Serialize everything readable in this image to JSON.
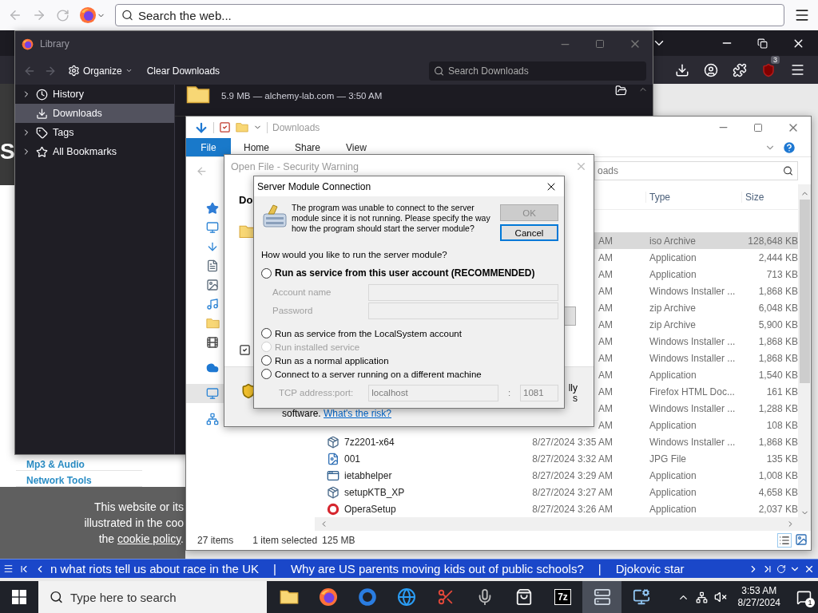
{
  "browser": {
    "search": {
      "placeholder": "Search the web..."
    },
    "extension_badge": "3",
    "page": {
      "logo_fragment": "S",
      "links": [
        "Mp3 & Audio",
        "Network Tools"
      ],
      "cookie_banner": {
        "lines": [
          "This website or its",
          "illustrated in the coo"
        ],
        "last_line": {
          "before": "the ",
          "link": "cookie policy",
          "after": "."
        }
      }
    }
  },
  "library": {
    "title": "Library",
    "organize": "Organize",
    "clear_button": "Clear Downloads",
    "search": {
      "placeholder": "Search Downloads"
    },
    "sidebar": [
      {
        "kind": "history",
        "label": "History",
        "expandable": true,
        "selected": false
      },
      {
        "kind": "downloads",
        "label": "Downloads",
        "expandable": false,
        "selected": true
      },
      {
        "kind": "tags",
        "label": "Tags",
        "expandable": true,
        "selected": false
      },
      {
        "kind": "bookmarks",
        "label": "All Bookmarks",
        "expandable": true,
        "selected": false
      }
    ],
    "download": {
      "details": "5.9 MB — alchemy-lab.com — 3:50 AM"
    }
  },
  "explorer": {
    "title": "Downloads",
    "ribbon_tabs": [
      {
        "label": "File",
        "selected": true
      },
      {
        "label": "Home",
        "selected": false
      },
      {
        "label": "Share",
        "selected": false
      },
      {
        "label": "View",
        "selected": false
      }
    ],
    "search": {
      "placeholder": "oads"
    },
    "nav_pane": [
      [
        {
          "kind": "quick-access",
          "selected": false
        },
        {
          "kind": "desktop",
          "selected": false
        },
        {
          "kind": "downloads",
          "selected": false
        },
        {
          "kind": "documents",
          "selected": false
        },
        {
          "kind": "pictures",
          "selected": false
        },
        {
          "kind": "music",
          "selected": false
        },
        {
          "kind": "folder",
          "selected": false
        },
        {
          "kind": "videos",
          "selected": false
        }
      ],
      [
        {
          "kind": "onedrive",
          "selected": false
        }
      ],
      [
        {
          "kind": "this-pc",
          "selected": true
        }
      ],
      [
        {
          "kind": "network",
          "selected": false
        }
      ]
    ],
    "columns": [
      "Type",
      "Size"
    ],
    "rows": [
      {
        "date": "AM",
        "type": "iso Archive",
        "size": "128,648 KB",
        "selected": true
      },
      {
        "date": "AM",
        "type": "Application",
        "size": "2,444 KB",
        "selected": false
      },
      {
        "date": "AM",
        "type": "Application",
        "size": "713 KB",
        "selected": false
      },
      {
        "date": "AM",
        "type": "Windows Installer ...",
        "size": "1,868 KB",
        "selected": false
      },
      {
        "date": "AM",
        "type": "zip Archive",
        "size": "6,048 KB",
        "selected": false
      },
      {
        "date": "AM",
        "type": "zip Archive",
        "size": "5,900 KB",
        "selected": false
      },
      {
        "date": "AM",
        "type": "Windows Installer ...",
        "size": "1,868 KB",
        "selected": false
      },
      {
        "date": "AM",
        "type": "Windows Installer ...",
        "size": "1,868 KB",
        "selected": false
      },
      {
        "date": "AM",
        "type": "Application",
        "size": "1,540 KB",
        "selected": false
      },
      {
        "date": "AM",
        "type": "Firefox HTML Doc...",
        "size": "161 KB",
        "selected": false
      },
      {
        "date": "AM",
        "type": "Windows Installer ...",
        "size": "1,288 KB",
        "selected": false
      },
      {
        "date": "AM",
        "type": "Application",
        "size": "108 KB",
        "selected": false
      },
      {
        "kind": "installer",
        "name": "7z2201-x64",
        "date": "8/27/2024 3:35 AM",
        "type": "Windows Installer ...",
        "size": "1,868 KB",
        "selected": false
      },
      {
        "kind": "image",
        "name": "001",
        "date": "8/27/2024 3:32 AM",
        "type": "JPG File",
        "size": "135 KB",
        "selected": false
      },
      {
        "kind": "window",
        "name": "ietabhelper",
        "date": "8/27/2024 3:29 AM",
        "type": "Application",
        "size": "1,008 KB",
        "selected": false
      },
      {
        "kind": "installer",
        "name": "setupKTB_XP",
        "date": "8/27/2024 3:27 AM",
        "type": "Application",
        "size": "4,658 KB",
        "selected": false
      },
      {
        "kind": "ring",
        "name": "OperaSetup",
        "date": "8/27/2024 3:26 AM",
        "type": "Application",
        "size": "2,037 KB",
        "selected": false
      }
    ],
    "status": {
      "count": "27 items",
      "selection": "1 item selected",
      "selection_size": "125 MB"
    }
  },
  "security_warning": {
    "title": "Open File - Security Warning",
    "heading": "Do",
    "checkbox": {
      "checked": true
    },
    "fragments": [
      "lly",
      "s"
    ],
    "footer": {
      "text": "software. ",
      "link": "What's the risk?"
    }
  },
  "server_dialog": {
    "title": "Server Module Connection",
    "message": "The program was unable to connect to the server module since it is not running. Please specify the way how the program should start the server module?",
    "buttons": [
      {
        "label": "OK",
        "disabled": true,
        "focused": false
      },
      {
        "label": "Cancel",
        "disabled": false,
        "focused": true
      }
    ],
    "question": "How would you like to run the server module?",
    "options": [
      {
        "label": "Run as service from this user account (RECOMMENDED)",
        "selected": false,
        "disabled": false,
        "emphasis": true,
        "fields": [
          {
            "label": "Account name",
            "disabled": true
          },
          {
            "label": "Password",
            "disabled": true
          }
        ]
      },
      {
        "label": "Run as service from the LocalSystem account",
        "selected": false,
        "disabled": false,
        "emphasis": false
      },
      {
        "label": "Run installed service",
        "selected": false,
        "disabled": true,
        "emphasis": false
      },
      {
        "label": "Run as a normal application",
        "selected": false,
        "disabled": false,
        "emphasis": false
      },
      {
        "label": "Connect to a server running on a different machine",
        "selected": false,
        "disabled": false,
        "emphasis": false,
        "address": {
          "label": "TCP address:port:",
          "host": "localhost",
          "separator": ":",
          "port": "1081",
          "disabled": true
        }
      }
    ]
  },
  "ticker": {
    "items": [
      {
        "kind": "headline",
        "text": "n what riots tell us about race in the UK"
      },
      {
        "kind": "separator",
        "text": "|"
      },
      {
        "kind": "headline",
        "text": "Why are US parents moving kids out of public schools?"
      },
      {
        "kind": "separator",
        "text": "|"
      },
      {
        "kind": "headline",
        "text": "Djokovic star"
      }
    ]
  },
  "taskbar": {
    "search": {
      "placeholder": "Type here to search"
    },
    "apps": [
      {
        "kind": "folder",
        "selected": false
      },
      {
        "kind": "firefox",
        "selected": false
      },
      {
        "kind": "ring",
        "selected": false
      },
      {
        "kind": "globe",
        "selected": false
      },
      {
        "kind": "scissors",
        "selected": false
      },
      {
        "kind": "mic",
        "selected": false
      },
      {
        "kind": "store",
        "selected": false
      },
      {
        "kind": "text-logo",
        "label": "7z",
        "selected": false
      },
      {
        "kind": "server",
        "selected": true
      },
      {
        "kind": "computer",
        "selected": false
      }
    ],
    "muted": true,
    "time": "3:53 AM",
    "date": "8/27/2024",
    "notifications": "1"
  }
}
